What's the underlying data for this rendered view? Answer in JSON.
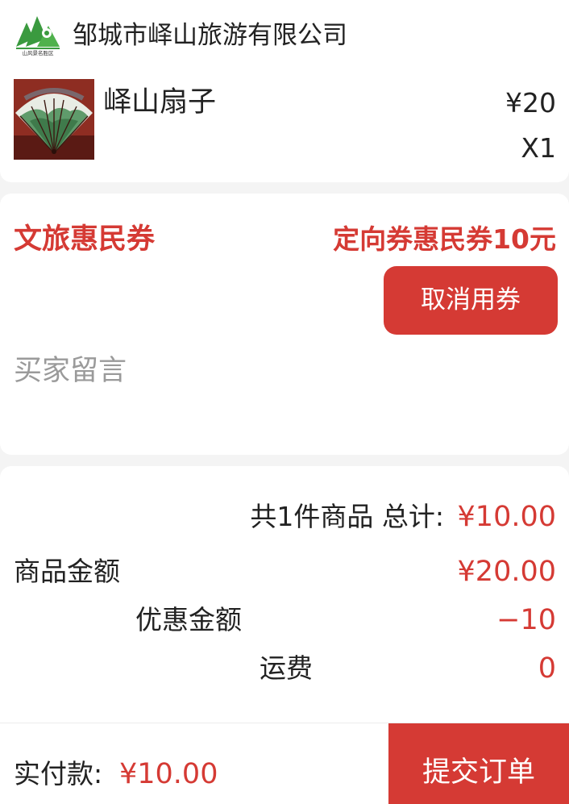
{
  "shop": {
    "logo_icon": "mountain-logo-icon",
    "logo_text": "山风景名胜区",
    "name": "邹城市峄山旅游有限公司"
  },
  "product": {
    "thumb_icon": "folding-fan-thumbnail",
    "name": "峄山扇子",
    "price": "¥20",
    "quantity": "X1"
  },
  "coupon": {
    "title": "文旅惠民券",
    "value": "定向券惠民券10元",
    "cancel_label": "取消用券"
  },
  "message": {
    "placeholder": "买家留言",
    "value": ""
  },
  "summary": {
    "count_label": "共1件商品 总计:",
    "total": "¥10.00",
    "goods_amount_label": "商品金额",
    "goods_amount": "¥20.00",
    "discount_label": "优惠金额",
    "discount": "−10",
    "shipping_label": "运费",
    "shipping": "0"
  },
  "footer": {
    "pay_label": "实付款:",
    "pay_value": "¥10.00",
    "submit_label": "提交订单"
  },
  "colors": {
    "accent": "#d53a34",
    "logo_green": "#3a9a3f",
    "background": "#f4f4f4"
  }
}
